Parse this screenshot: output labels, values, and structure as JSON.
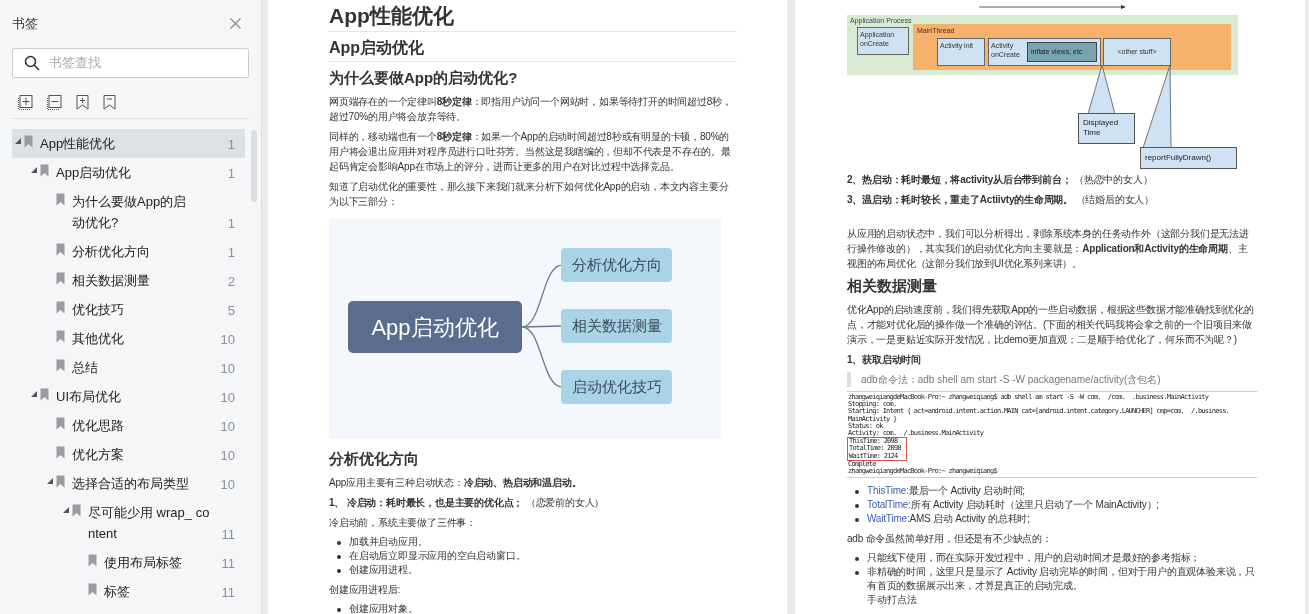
{
  "sidebar": {
    "title": "书签",
    "search": {
      "placeholder": "书签查找"
    },
    "items": [
      {
        "label": "App性能优化",
        "page": "1",
        "selected": true,
        "expanded": true,
        "children": [
          {
            "label": "App启动优化",
            "page": "1",
            "selected": false,
            "expanded": true,
            "children": [
              {
                "label": "为什么要做App的启动优化?",
                "page": "1",
                "selected": false
              },
              {
                "label": "分析优化方向",
                "page": "1",
                "selected": false
              },
              {
                "label": "相关数据测量",
                "page": "2",
                "selected": false
              },
              {
                "label": "优化技巧",
                "page": "5",
                "selected": false
              },
              {
                "label": "其他优化",
                "page": "10",
                "selected": false
              },
              {
                "label": "总结",
                "page": "10",
                "selected": false
              }
            ]
          },
          {
            "label": "UI布局优化",
            "page": "10",
            "selected": false,
            "expanded": true,
            "children": [
              {
                "label": "优化思路",
                "page": "10",
                "selected": false
              },
              {
                "label": "优化方案",
                "page": "10",
                "selected": false
              },
              {
                "label": "选择合适的布局类型",
                "page": "10",
                "selected": false,
                "expanded": true,
                "children": [
                  {
                    "label": "尽可能少用 wrap_ content",
                    "page": "11",
                    "selected": false,
                    "expanded": true,
                    "children": [
                      {
                        "label": "使用布局标签",
                        "page": "11",
                        "selected": false
                      },
                      {
                        "label": "标签",
                        "page": "11",
                        "selected": false
                      }
                    ]
                  }
                ]
              }
            ]
          }
        ]
      }
    ]
  },
  "pages": [
    {
      "blocks": [
        {
          "kind": "h1",
          "text": "App性能优化"
        },
        {
          "kind": "h2",
          "text": "App启动优化"
        },
        {
          "kind": "h3",
          "text": "为什么要做App的启动优化?"
        },
        {
          "kind": "p",
          "text": "网页端存在的一个定律叫**8秒定律**：即指用户访问一个网站时，如果等待打开的时间超过8秒，超过70%的用户将会放弃等待。"
        },
        {
          "kind": "p",
          "text": "同样的，移动端也有一个**8秒定律**：如果一个App的启动时间超过8秒或有明显的卡顿，80%的用户将会退出应用并对程序员进行口吐芬芳。当然这是我瞎编的，但却不代表是不存在的。最起码肯定会影响App在市场上的评分，进而让更多的用户在对比过程中选择竞品。"
        },
        {
          "kind": "p",
          "text": "知道了启动优化的重要性，那么接下来我们就来分析下如何优化App的启动，本文内容主要分为以下三部分："
        },
        {
          "kind": "mindmap",
          "center": "App启动优化",
          "branches": [
            "分析优化方向",
            "相关数据测量",
            "启动优化技巧"
          ]
        },
        {
          "kind": "h3",
          "text": "分析优化方向"
        },
        {
          "kind": "p",
          "text": "App应用主要有三种启动状态：**冷启动、热启动和温启动。**"
        },
        {
          "kind": "p",
          "text": " **1、 冷启动：耗时最长，也是主要的优化点；** （恋爱前的女人）"
        },
        {
          "kind": "p",
          "text": "冷启动前，系统主要做了三件事："
        },
        {
          "kind": "ul",
          "items": [
            {
              "text": "加载并启动应用。"
            },
            {
              "text": "在启动后立即显示应用的空白启动窗口。"
            },
            {
              "text": "创建应用进程。"
            }
          ]
        },
        {
          "kind": "p",
          "text": "创建应用进程后:"
        },
        {
          "kind": "ul",
          "items": [
            {
              "text": "创建应用对象。"
            }
          ]
        }
      ]
    },
    {
      "blocks": [
        {
          "kind": "diagram",
          "process": "Application Process",
          "app_box": "Application onCreate",
          "thread": "MainThread",
          "boxes": [
            "Activity init",
            "Activity onCreate",
            "<other stuff>"
          ],
          "inner": "inflate views, etc",
          "callouts": [
            "Displayed Time",
            "reportFullyDrawn()"
          ]
        },
        {
          "kind": "p",
          "text": "**2、热启动：耗时最短，将activity从后台带到前台；** （热恋中的女人）"
        },
        {
          "kind": "p",
          "text": "**3、温启动：耗时较长，重走了Actiivty的生命周期。** （结婚后的女人）"
        },
        {
          "kind": "gap"
        },
        {
          "kind": "p",
          "text": "从应用的启动状态中，我们可以分析得出，剥除系统本身的任务动作外（这部分我们是无法进行操作修改的），其实我们的启动优化方向主要就是：**Application和Activity的生命周期**、主视图的布局优化（这部分我们放到UI优化系列来讲）。"
        },
        {
          "kind": "h3",
          "text": "相关数据测量"
        },
        {
          "kind": "p",
          "text": "优化App的启动速度前，我们得先获取App的一些启动数据，根据这些数据才能准确找到优化的点，才能对优化后的操作做一个准确的评估。(下面的相关代码我将会拿之前的一个旧项目来做演示，一是更贴近实际开发情况，比demo更加直观；二是顺手给优化了，何乐而不为呢？)"
        },
        {
          "kind": "p",
          "text": "**1、获取启动时间**"
        },
        {
          "kind": "quote",
          "text": "adb命令法：adb shell am start -S -W packagename/activity(含包名)"
        },
        {
          "kind": "terminal",
          "lines": [
            {
              "text": "zhangweiqiangdeMacBook-Pro:~ zhangweiqiang$ adb shell am start -S -W com.  /com.  .business.MainActivity",
              "highlight": false
            },
            {
              "text": "Stopping: com.",
              "highlight": false
            },
            {
              "text": "Starting: Intent { act=android.intent.action.MAIN cat=[android.intent.category.LAUNCHER] cmp=com.  /.business.",
              "highlight": false
            },
            {
              "text": "MainActivity }",
              "highlight": false
            },
            {
              "text": "Status: ok",
              "highlight": false
            },
            {
              "text": "Activity: com.  /.business.MainActivity",
              "highlight": false
            },
            {
              "text": "ThisTime: 2098",
              "highlight": true
            },
            {
              "text": "TotalTime: 2098",
              "highlight": true
            },
            {
              "text": "WaitTime: 2124",
              "highlight": true
            },
            {
              "text": "Complete",
              "highlight": false
            },
            {
              "text": "zhangweiqiangdeMacBook-Pro:~ zhangweiqiang$",
              "highlight": false
            }
          ]
        },
        {
          "kind": "ul",
          "items": [
            {
              "lead": "ThisTime:",
              "text": "最后一个 Activity 启动时间;"
            },
            {
              "lead": "TotalTime:",
              "text": "所有 Activity 启动耗时（这里只启动了一个 MainActivity）;"
            },
            {
              "lead": "WaitTime:",
              "text": "AMS 启动 Activity 的总耗时;"
            }
          ]
        },
        {
          "kind": "p",
          "text": "adb 命令虽然简单好用，但还是有不少缺点的："
        },
        {
          "kind": "ul",
          "items": [
            {
              "text": "只能线下使用，而在实际开发过程中，用户的启动时间才是最好的参考指标；"
            },
            {
              "text": "非精确的时间，这里只是显示了 Activity 启动完毕的时间，但对于用户的直观体验来说，只有首页的数据展示出来，才算是真正的启动完成。",
              "sub": "手动打点法"
            }
          ]
        }
      ]
    }
  ]
}
